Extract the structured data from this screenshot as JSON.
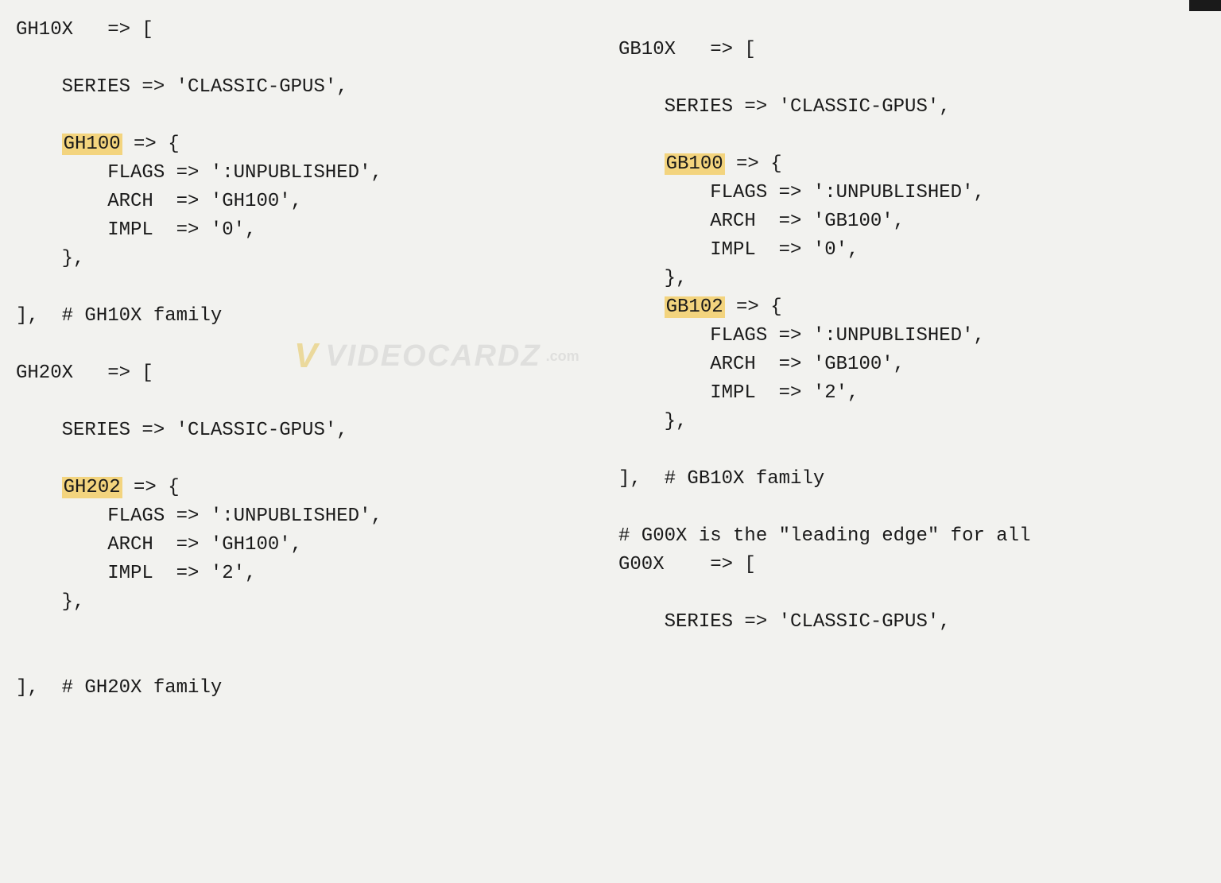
{
  "watermark": {
    "logo": "V",
    "text": "VIDEOCARDZ",
    "suffix": ".com"
  },
  "left_col": {
    "gh10x": {
      "name": "GH10X",
      "arrow": "   => [",
      "series_line": "    SERIES => 'CLASSIC-GPUS',",
      "chip": {
        "indent": "    ",
        "name": "GH100",
        "arrow": " => {",
        "flags": "        FLAGS => ':UNPUBLISHED',",
        "arch": "        ARCH  => 'GH100',",
        "impl": "        IMPL  => '0',",
        "close": "    },"
      },
      "close": "],  # GH10X family"
    },
    "gh20x": {
      "name": "GH20X",
      "arrow": "   => [",
      "series_line": "    SERIES => 'CLASSIC-GPUS',",
      "chip": {
        "indent": "    ",
        "name": "GH202",
        "arrow": " => {",
        "flags": "        FLAGS => ':UNPUBLISHED',",
        "arch": "        ARCH  => 'GH100',",
        "impl": "        IMPL  => '2',",
        "close": "    },"
      },
      "close": "],  # GH20X family"
    }
  },
  "right_col": {
    "gb10x": {
      "name": "GB10X",
      "arrow": "   => [",
      "series_line": "    SERIES => 'CLASSIC-GPUS',",
      "chip1": {
        "indent": "    ",
        "name": "GB100",
        "arrow": " => {",
        "flags": "        FLAGS => ':UNPUBLISHED',",
        "arch": "        ARCH  => 'GB100',",
        "impl": "        IMPL  => '0',",
        "close": "    },"
      },
      "chip2": {
        "indent": "    ",
        "name": "GB102",
        "arrow": " => {",
        "flags": "        FLAGS => ':UNPUBLISHED',",
        "arch": "        ARCH  => 'GB100',",
        "impl": "        IMPL  => '2',",
        "close": "    },"
      },
      "close": "],  # GB10X family"
    },
    "g00x": {
      "comment": "# G00X is the \"leading edge\" for all",
      "name": "G00X",
      "arrow": "    => [",
      "series_line": "    SERIES => 'CLASSIC-GPUS',"
    }
  }
}
